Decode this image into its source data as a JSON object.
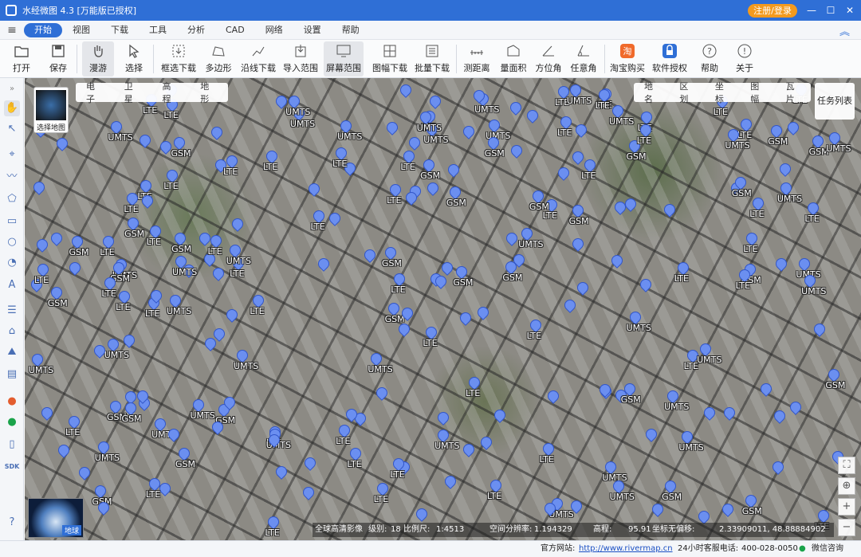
{
  "window": {
    "title": "水经微图 4.3 [万能版已授权]",
    "login_label": "注册/登录",
    "min_label": "—",
    "max_label": "☐",
    "close_label": "✕"
  },
  "menu": {
    "items": [
      "开始",
      "视图",
      "下载",
      "工具",
      "分析",
      "CAD",
      "网络",
      "设置",
      "帮助"
    ]
  },
  "toolbar": {
    "items": [
      "打开",
      "保存",
      "漫游",
      "选择",
      "框选下载",
      "多边形",
      "沿线下载",
      "导入范围",
      "屏幕范围",
      "图幅下载",
      "批量下载",
      "测距离",
      "量面积",
      "方位角",
      "任意角",
      "淘宝购买",
      "软件授权",
      "帮助",
      "关于"
    ]
  },
  "map": {
    "layer_select_label": "选择地图",
    "type_tabs": [
      "电子",
      "卫星",
      "高程",
      "地形"
    ],
    "overlay_tabs": [
      "地名",
      "区划",
      "坐标",
      "图幅",
      "瓦片"
    ],
    "task_list_label": "任务列表",
    "globe_label": "地球",
    "marker_labels": [
      "LTE",
      "UMTS",
      "GSM"
    ],
    "status": {
      "source": "全球高清影像",
      "level_label": "级别:",
      "level": "18",
      "scale_label": "比例尺:",
      "scale": "1:4513",
      "resolution_label": "空间分辨率:",
      "resolution": "1.194329",
      "elevation_label": "高程:",
      "elevation": "95.91",
      "coord_label": "坐标无偏移:",
      "coord": "2.33909011, 48.88884902"
    }
  },
  "statusbar": {
    "website_label": "官方网站:",
    "website": "http://www.rivermap.cn",
    "hotline_label": "24小时客服电话:",
    "hotline": "400-028-0050",
    "wechat_label": "微信咨询"
  },
  "colors": {
    "accent": "#2f6fd6",
    "login": "#f39a1e",
    "marker": "#6b8ff0"
  }
}
